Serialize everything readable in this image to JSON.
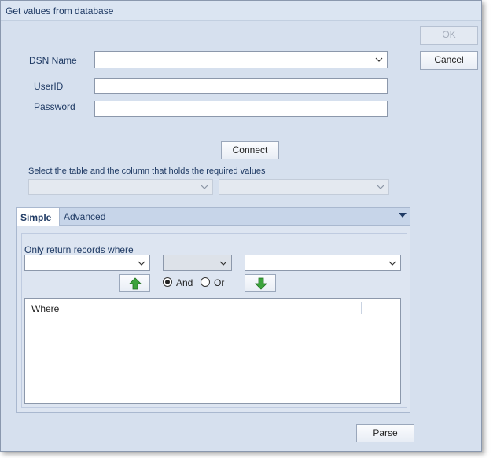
{
  "window": {
    "title": "Get values from database"
  },
  "buttons": {
    "ok": "OK",
    "cancel": "Cancel",
    "connect": "Connect",
    "parse": "Parse"
  },
  "fields": {
    "dsn_label": "DSN Name",
    "dsn_value": "",
    "userid_label": "UserID",
    "userid_value": "",
    "password_label": "Password",
    "password_value": ""
  },
  "table_select": {
    "label": "Select the table and the column that holds the required values",
    "table_value": "",
    "column_value": ""
  },
  "tabs": [
    {
      "label": "Simple",
      "selected": true
    },
    {
      "label": "Advanced",
      "selected": false
    }
  ],
  "simple": {
    "group_label": "Only return records where",
    "field_value": "",
    "operator_value": "",
    "criteria_value": "",
    "and_label": "And",
    "or_label": "Or",
    "and_checked": true,
    "grid": {
      "columns": [
        "Where",
        ""
      ],
      "rows": []
    }
  },
  "colors": {
    "window_bg": "#d6e0ee",
    "title_text": "#1f3a64",
    "arrow_green": "#3ca33c"
  },
  "icons": {
    "up": "arrow-up-icon",
    "down": "arrow-down-icon",
    "dropdown": "chevron-down-icon",
    "tab_menu": "triangle-down-icon"
  }
}
